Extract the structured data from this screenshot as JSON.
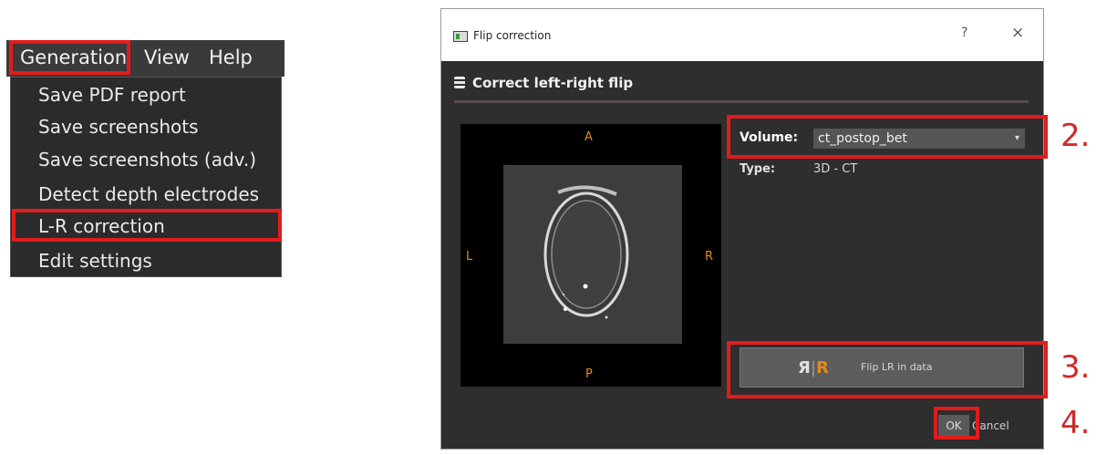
{
  "menubar": {
    "items": [
      "Generation",
      "View",
      "Help"
    ]
  },
  "generation_menu": {
    "items": [
      "Save PDF report",
      "Save screenshots",
      "Save screenshots (adv.)",
      "Detect depth electrodes",
      "L-R correction",
      "Edit settings"
    ]
  },
  "dialog": {
    "title": "Flip correction",
    "help_label": "?",
    "close_label": "×",
    "section_title": "Correct left-right flip",
    "viewer": {
      "orient_top": "A",
      "orient_left": "L",
      "orient_right": "R",
      "orient_bottom": "P"
    },
    "volume_label": "Volume:",
    "volume_value": "ct_postop_bet",
    "type_label": "Type:",
    "type_value": "3D - CT",
    "flip_icon_left": "Я",
    "flip_icon_sep": "|",
    "flip_icon_right": "R",
    "flip_label": "Flip LR in data",
    "ok_label": "OK",
    "cancel_label": "Cancel"
  },
  "steps": [
    "2.",
    "3.",
    "4."
  ],
  "colors": {
    "highlight": "#e31b1b",
    "step_text": "#cf2a2a",
    "accent": "#e58a1c"
  }
}
